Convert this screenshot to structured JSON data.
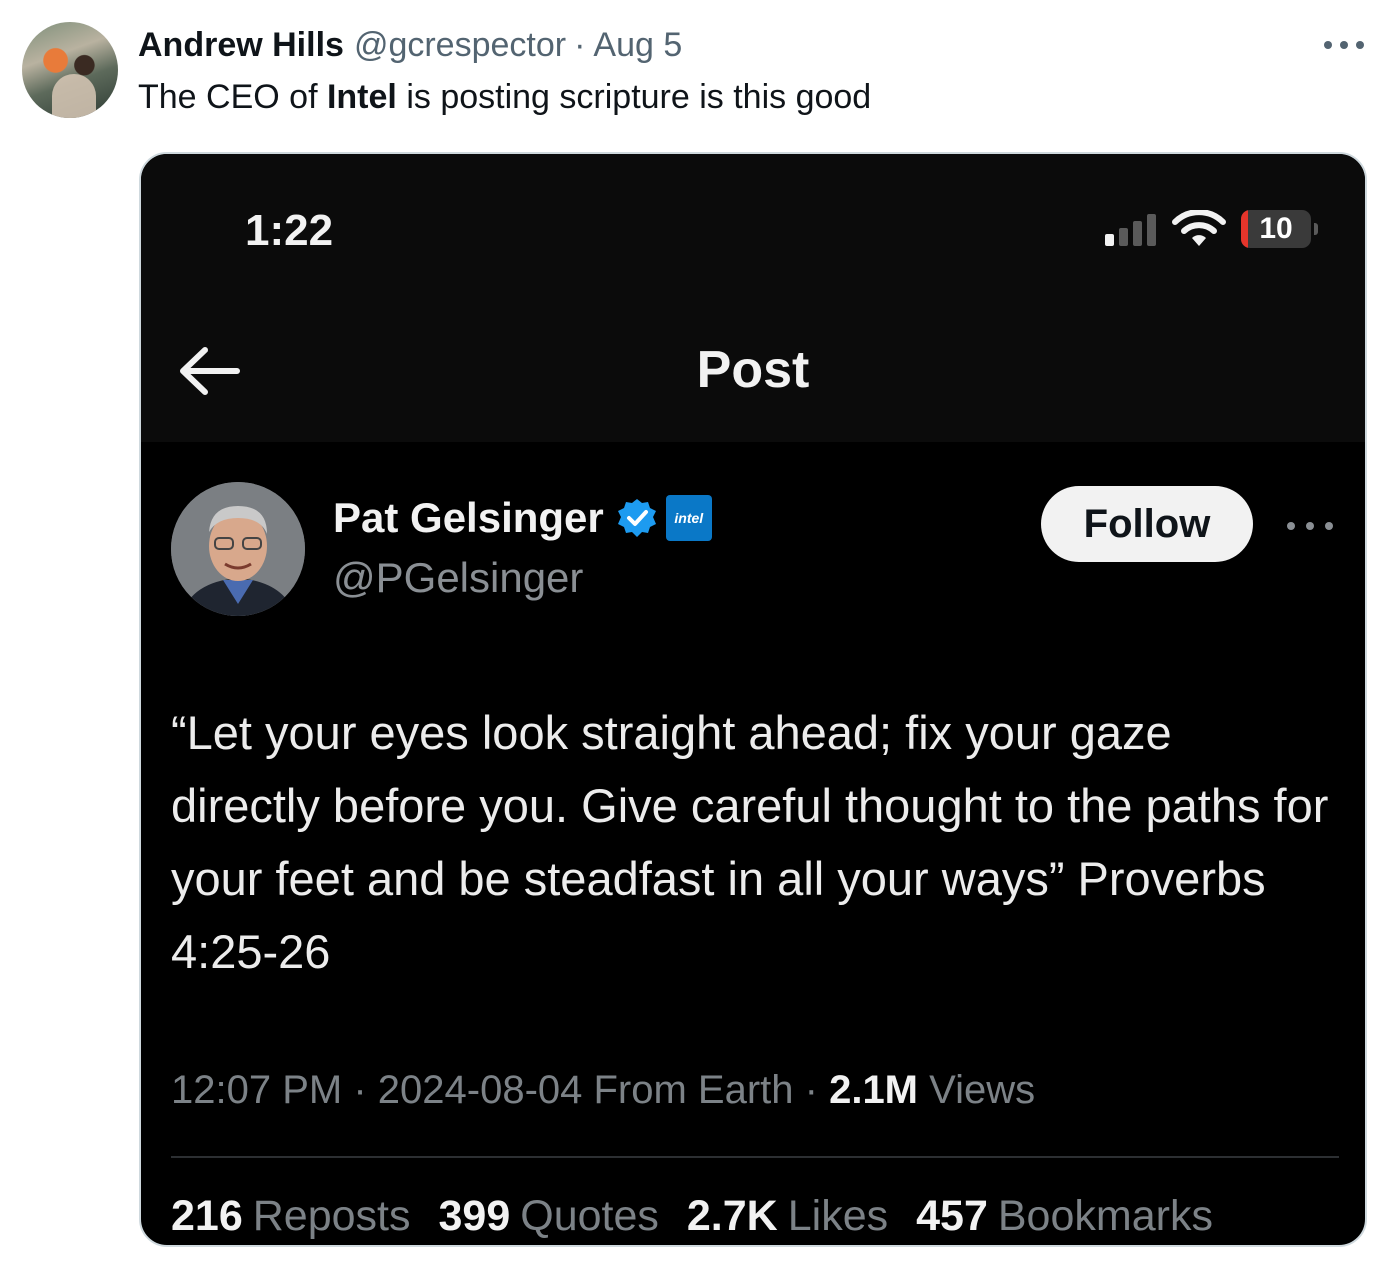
{
  "outer_tweet": {
    "author_name": "Andrew Hills",
    "author_handle": "@gcrespector",
    "separator": "·",
    "date": "Aug 5",
    "text_prefix": "The CEO of ",
    "text_bold": "Intel",
    "text_suffix": " is posting scripture is this good"
  },
  "embedded_screenshot": {
    "status_bar": {
      "time": "1:22",
      "battery_level": "10",
      "battery_fraction": 0.1,
      "battery_color": "#e5352b"
    },
    "nav": {
      "title": "Post"
    },
    "post": {
      "author_name": "Pat Gelsinger",
      "author_handle": "@PGelsinger",
      "affiliate_badge": "intel",
      "follow_label": "Follow",
      "text": "“Let your eyes look straight ahead; fix your gaze directly before you. Give careful thought to the paths for your feet and be steadfast in all your ways” Proverbs 4:25-26",
      "meta": {
        "time": "12:07 PM",
        "sep1": " · ",
        "date": "2024-08-04",
        "location": " From Earth",
        "sep2": " · ",
        "views_count": "2.1M",
        "views_label": " Views"
      },
      "stats": [
        {
          "count": "216",
          "label": "Reposts"
        },
        {
          "count": "399",
          "label": "Quotes"
        },
        {
          "count": "2.7K",
          "label": "Likes"
        },
        {
          "count": "457",
          "label": "Bookmarks"
        }
      ]
    }
  },
  "colors": {
    "verified_blue": "#1d9bf0",
    "intel_blue": "#0a78c7",
    "secondary_text": "#536471"
  },
  "icons": [
    "more-icon",
    "signal-icon",
    "wifi-icon",
    "battery-icon",
    "back-arrow-icon",
    "verified-badge-icon",
    "intel-affiliate-icon"
  ]
}
